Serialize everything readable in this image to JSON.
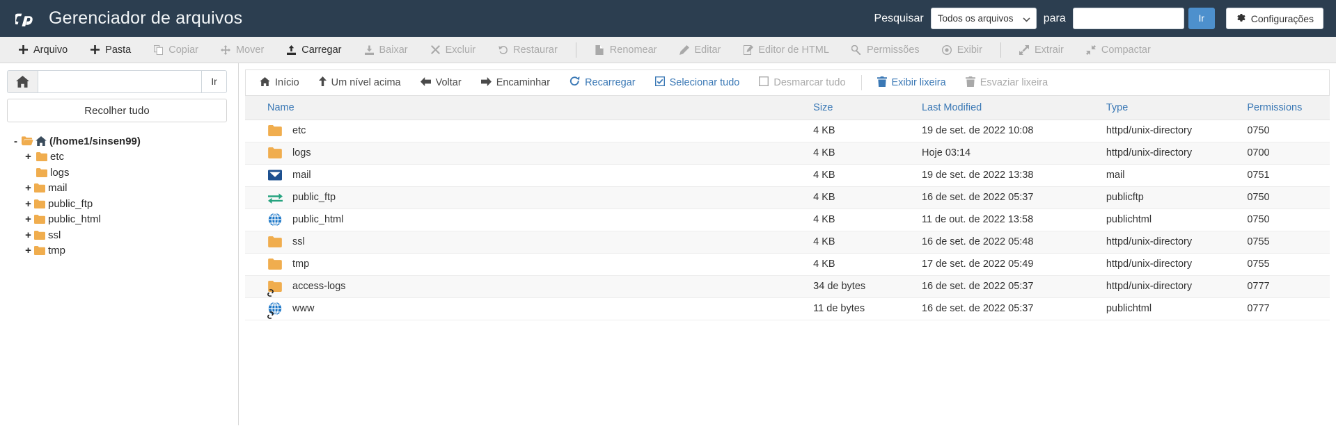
{
  "header": {
    "logo": "cpanel-logo",
    "title": "Gerenciador de arquivos",
    "search_label": "Pesquisar",
    "search_scope_selected": "Todos os arquivos",
    "search_scope_options": [
      "Todos os arquivos"
    ],
    "search_for_label": "para",
    "search_value": "",
    "search_placeholder": "",
    "go_label": "Ir",
    "settings_label": "Configurações",
    "accent_blue": "#4d90cd",
    "header_bg": "#2c3e50"
  },
  "toolbar": {
    "groups": [
      [
        {
          "icon": "plus-icon",
          "label": "Arquivo",
          "enabled": true
        },
        {
          "icon": "plus-icon",
          "label": "Pasta",
          "enabled": true
        },
        {
          "icon": "copy-icon",
          "label": "Copiar",
          "enabled": false
        },
        {
          "icon": "move-icon",
          "label": "Mover",
          "enabled": false
        },
        {
          "icon": "upload-icon",
          "label": "Carregar",
          "enabled": true
        },
        {
          "icon": "download-icon",
          "label": "Baixar",
          "enabled": false
        },
        {
          "icon": "delete-icon",
          "label": "Excluir",
          "enabled": false
        },
        {
          "icon": "restore-icon",
          "label": "Restaurar",
          "enabled": false
        }
      ],
      [
        {
          "icon": "rename-icon",
          "label": "Renomear",
          "enabled": false
        },
        {
          "icon": "edit-icon",
          "label": "Editar",
          "enabled": false
        },
        {
          "icon": "html-editor-icon",
          "label": "Editor de HTML",
          "enabled": false
        },
        {
          "icon": "permissions-icon",
          "label": "Permissões",
          "enabled": false
        },
        {
          "icon": "view-icon",
          "label": "Exibir",
          "enabled": false
        }
      ],
      [
        {
          "icon": "extract-icon",
          "label": "Extrair",
          "enabled": false
        },
        {
          "icon": "compress-icon",
          "label": "Compactar",
          "enabled": false
        }
      ]
    ]
  },
  "sidebar": {
    "home_icon": "home-icon",
    "path_value": "",
    "path_placeholder": "",
    "go_label": "Ir",
    "collapse_label": "Recolher tudo",
    "tree": [
      {
        "toggle": "-",
        "icon": "folder-open-home-icon",
        "label": "(/home1/sinsen99)",
        "depth": 0,
        "root": true
      },
      {
        "toggle": "+",
        "icon": "folder-icon",
        "label": "etc",
        "depth": 1,
        "root": false
      },
      {
        "toggle": "",
        "icon": "folder-icon",
        "label": "logs",
        "depth": 1,
        "root": false
      },
      {
        "toggle": "+",
        "icon": "folder-icon",
        "label": "mail",
        "depth": 1,
        "root": false
      },
      {
        "toggle": "+",
        "icon": "folder-icon",
        "label": "public_ftp",
        "depth": 1,
        "root": false
      },
      {
        "toggle": "+",
        "icon": "folder-icon",
        "label": "public_html",
        "depth": 1,
        "root": false
      },
      {
        "toggle": "+",
        "icon": "folder-icon",
        "label": "ssl",
        "depth": 1,
        "root": false
      },
      {
        "toggle": "+",
        "icon": "folder-icon",
        "label": "tmp",
        "depth": 1,
        "root": false
      }
    ]
  },
  "filenav": {
    "items": [
      {
        "icon": "home-icon",
        "label": "Início",
        "state": "dark"
      },
      {
        "icon": "up-level-icon",
        "label": "Um nível acima",
        "state": "dark"
      },
      {
        "icon": "back-icon",
        "label": "Voltar",
        "state": "dark"
      },
      {
        "icon": "forward-icon",
        "label": "Encaminhar",
        "state": "dark"
      },
      {
        "icon": "reload-icon",
        "label": "Recarregar",
        "state": "blue"
      },
      {
        "icon": "check-all-icon",
        "label": "Selecionar tudo",
        "state": "blue"
      },
      {
        "icon": "uncheck-icon",
        "label": "Desmarcar tudo",
        "state": "gray"
      },
      {
        "icon": "trash-icon",
        "label": "Exibir lixeira",
        "state": "blue"
      },
      {
        "icon": "trash-icon",
        "label": "Esvaziar lixeira",
        "state": "gray"
      }
    ],
    "separator_after": [
      6,
      7
    ]
  },
  "filetable": {
    "columns": [
      "Name",
      "Size",
      "Last Modified",
      "Type",
      "Permissions"
    ],
    "rows": [
      {
        "icon": "folder-icon",
        "name": "etc",
        "size": "4 KB",
        "modified": "19 de set. de 2022 10:08",
        "type": "httpd/unix-directory",
        "permissions": "0750"
      },
      {
        "icon": "folder-icon",
        "name": "logs",
        "size": "4 KB",
        "modified": "Hoje 03:14",
        "type": "httpd/unix-directory",
        "permissions": "0700"
      },
      {
        "icon": "mail-icon",
        "name": "mail",
        "size": "4 KB",
        "modified": "19 de set. de 2022 13:38",
        "type": "mail",
        "permissions": "0751"
      },
      {
        "icon": "ftp-icon",
        "name": "public_ftp",
        "size": "4 KB",
        "modified": "16 de set. de 2022 05:37",
        "type": "publicftp",
        "permissions": "0750"
      },
      {
        "icon": "globe-icon",
        "name": "public_html",
        "size": "4 KB",
        "modified": "11 de out. de 2022 13:58",
        "type": "publichtml",
        "permissions": "0750"
      },
      {
        "icon": "folder-icon",
        "name": "ssl",
        "size": "4 KB",
        "modified": "16 de set. de 2022 05:48",
        "type": "httpd/unix-directory",
        "permissions": "0755"
      },
      {
        "icon": "folder-icon",
        "name": "tmp",
        "size": "4 KB",
        "modified": "17 de set. de 2022 05:49",
        "type": "httpd/unix-directory",
        "permissions": "0755"
      },
      {
        "icon": "folder-symlink-icon",
        "name": "access-logs",
        "size": "34 de bytes",
        "modified": "16 de set. de 2022 05:37",
        "type": "httpd/unix-directory",
        "permissions": "0777"
      },
      {
        "icon": "globe-symlink-icon",
        "name": "www",
        "size": "11 de bytes",
        "modified": "16 de set. de 2022 05:37",
        "type": "publichtml",
        "permissions": "0777"
      }
    ]
  }
}
